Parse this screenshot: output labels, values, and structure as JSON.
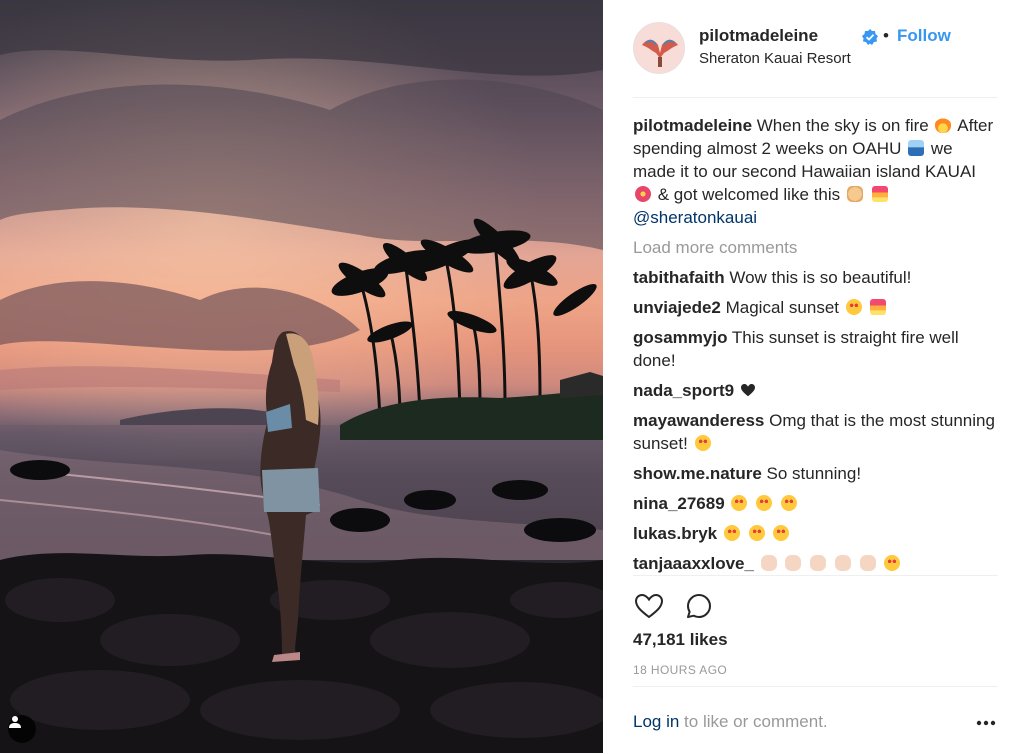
{
  "post": {
    "username": "pilotmadeleine",
    "separator": "•",
    "follow_label": "Follow",
    "location": "Sheraton Kauai Resort",
    "caption": {
      "username": "pilotmadeleine",
      "line1": "When the sky is on fire",
      "line2": "After spending almost 2 weeks on OAHU",
      "line3": "we made it to our second Hawaiian island KAUAI",
      "line4": "& got welcomed like this",
      "mention": "@sheratonkauai"
    },
    "load_more": "Load more comments",
    "comments": [
      {
        "user": "tabithafaith",
        "text": "Wow this is so beautiful!"
      },
      {
        "user": "unviajede2",
        "text": "Magical sunset"
      },
      {
        "user": "gosammyjo",
        "text": "This sunset is straight fire well done!"
      },
      {
        "user": "nada_sport9",
        "text": ""
      },
      {
        "user": "mayawanderess",
        "text": "Omg that is the most stunning sunset!"
      },
      {
        "user": "show.me.nature",
        "text": "So stunning!"
      },
      {
        "user": "nina_27689",
        "text": ""
      },
      {
        "user": "lukas.bryk",
        "text": ""
      },
      {
        "user": "tanjaaaxxlove_",
        "text": ""
      }
    ],
    "likes": "47,181 likes",
    "time_ago": "18 HOURS AGO",
    "login_link": "Log in",
    "login_suffix": " to like or comment."
  },
  "icons": {
    "verified": "verified-badge-icon",
    "like": "heart-icon",
    "comment": "comment-icon",
    "more": "more-options-icon",
    "user_tag": "user-tag-icon"
  },
  "colors": {
    "link_blue": "#3897f0",
    "mention_blue": "#003569",
    "muted": "#999999",
    "text": "#262626"
  }
}
